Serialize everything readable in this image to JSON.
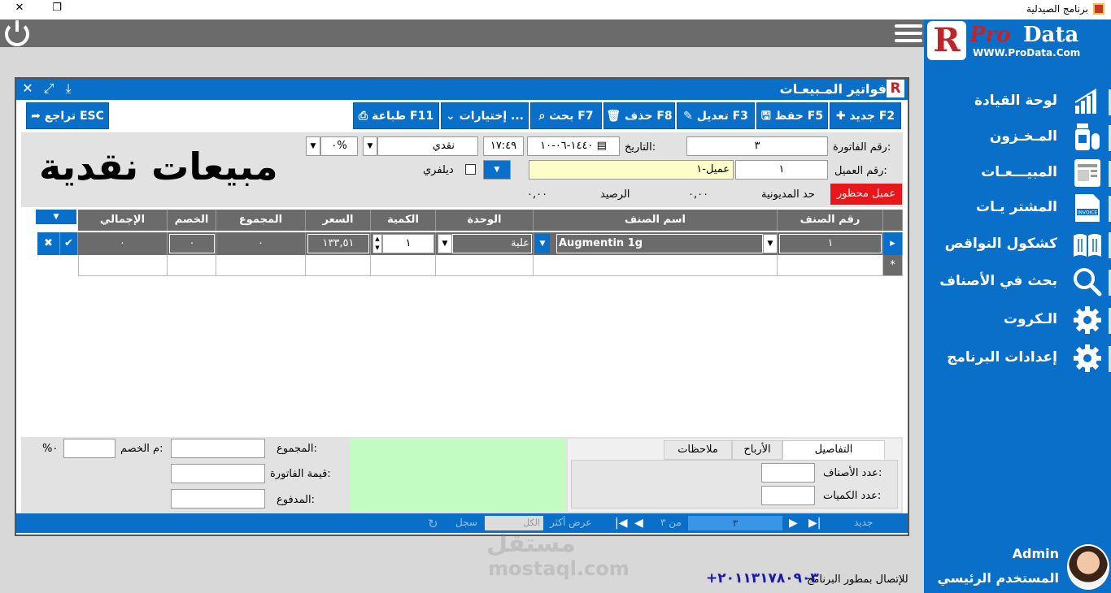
{
  "window": {
    "title": "برنامج الصيدلية",
    "minimize": "–",
    "maximize": "❐",
    "close": "✕"
  },
  "logo": {
    "pro": "Pro",
    "data": "Data",
    "url": "WWW.ProData.Com",
    "r": "R"
  },
  "sidebar": {
    "items": [
      {
        "label": "لوحة القيادة",
        "icon": "chart-icon"
      },
      {
        "label": "المـخـزون",
        "icon": "medicine-icon"
      },
      {
        "label": "المبيـــعـات",
        "icon": "sales-invoice-icon"
      },
      {
        "label": "المشتر يـات",
        "icon": "purchase-invoice-icon"
      },
      {
        "label": "كشكول النواقص",
        "icon": "book-icon"
      },
      {
        "label": "بحث في الأصناف",
        "icon": "search-icon"
      },
      {
        "label": "الـكروت",
        "icon": "gear-icon"
      },
      {
        "label": "إعدادات البرنامج",
        "icon": "gear-icon"
      }
    ],
    "user_name": "Admin",
    "user_role": "المستخدم الرئيسي"
  },
  "contact": {
    "label": "للإتصال بمطور البرنامج",
    "phone": "+٢٠١١٣١٧٨٠٩٠٣"
  },
  "watermark": {
    "line1": "مستقل",
    "line2": "mostaql.com"
  },
  "invoice": {
    "window_title": "فواتير المـبيعـات",
    "logo_letter": "R",
    "toolbar": {
      "new": "جديد F2",
      "save": "حفظ F5",
      "edit": "تعديل F3",
      "delete": "حذف F8",
      "search": "بحث F7",
      "options": "إختيارات ...",
      "print": "طباعة F11",
      "back": "تراجع ESC"
    },
    "big_title": "مبيعات نقدية",
    "form": {
      "invoice_no_label": "رقم الفاتورة:",
      "invoice_no": "٣",
      "date_label": "التاريخ:",
      "date": "١٤٤٠-٠٦-١٠",
      "time": "١٧:٤٩",
      "payment": "نقدي",
      "discount_pct": "٠%",
      "customer_no_label": "رقم العميل:",
      "customer_no": "١",
      "customer_name": "عميل-١",
      "delivery_label": "ديلفري",
      "banned": "عميل محظور",
      "debt_limit_label": "حد المديونية",
      "debt_limit": "٠,٠٠",
      "balance_label": "الرصيد",
      "balance": "٠,٠٠"
    },
    "grid": {
      "headers": [
        "رقم الصنف",
        "اسم الصنف",
        "الوحدة",
        "الكمية",
        "السعر",
        "المجموع",
        "الخصم",
        "الإجمالي"
      ],
      "rows": [
        {
          "item_no": "١",
          "item_name": "Augmentin 1g",
          "unit": "علبة",
          "qty": "١",
          "price": "١٣٣,٥١",
          "sum": "٠",
          "discount": "٠",
          "total": "٠"
        }
      ],
      "new_row_marker": "*"
    },
    "totals": {
      "sum_label": "المجموع:",
      "invoice_value_label": "قيمة الفاتورة:",
      "paid_label": "المدفوع:",
      "discount_label": "م الخصم:",
      "discount_pct": "%٠"
    },
    "tabs": [
      "التفاصيل",
      "الأرباح",
      "ملاحظات"
    ],
    "details": {
      "items_count_label": "عدد الأصناف:",
      "qty_count_label": "عدد الكميات:"
    },
    "statusbar": {
      "new": "جديد",
      "record": "٣",
      "of": "من ٣",
      "show_more": "عرض أكثر",
      "all": "الكل",
      "log": "سجل"
    }
  }
}
